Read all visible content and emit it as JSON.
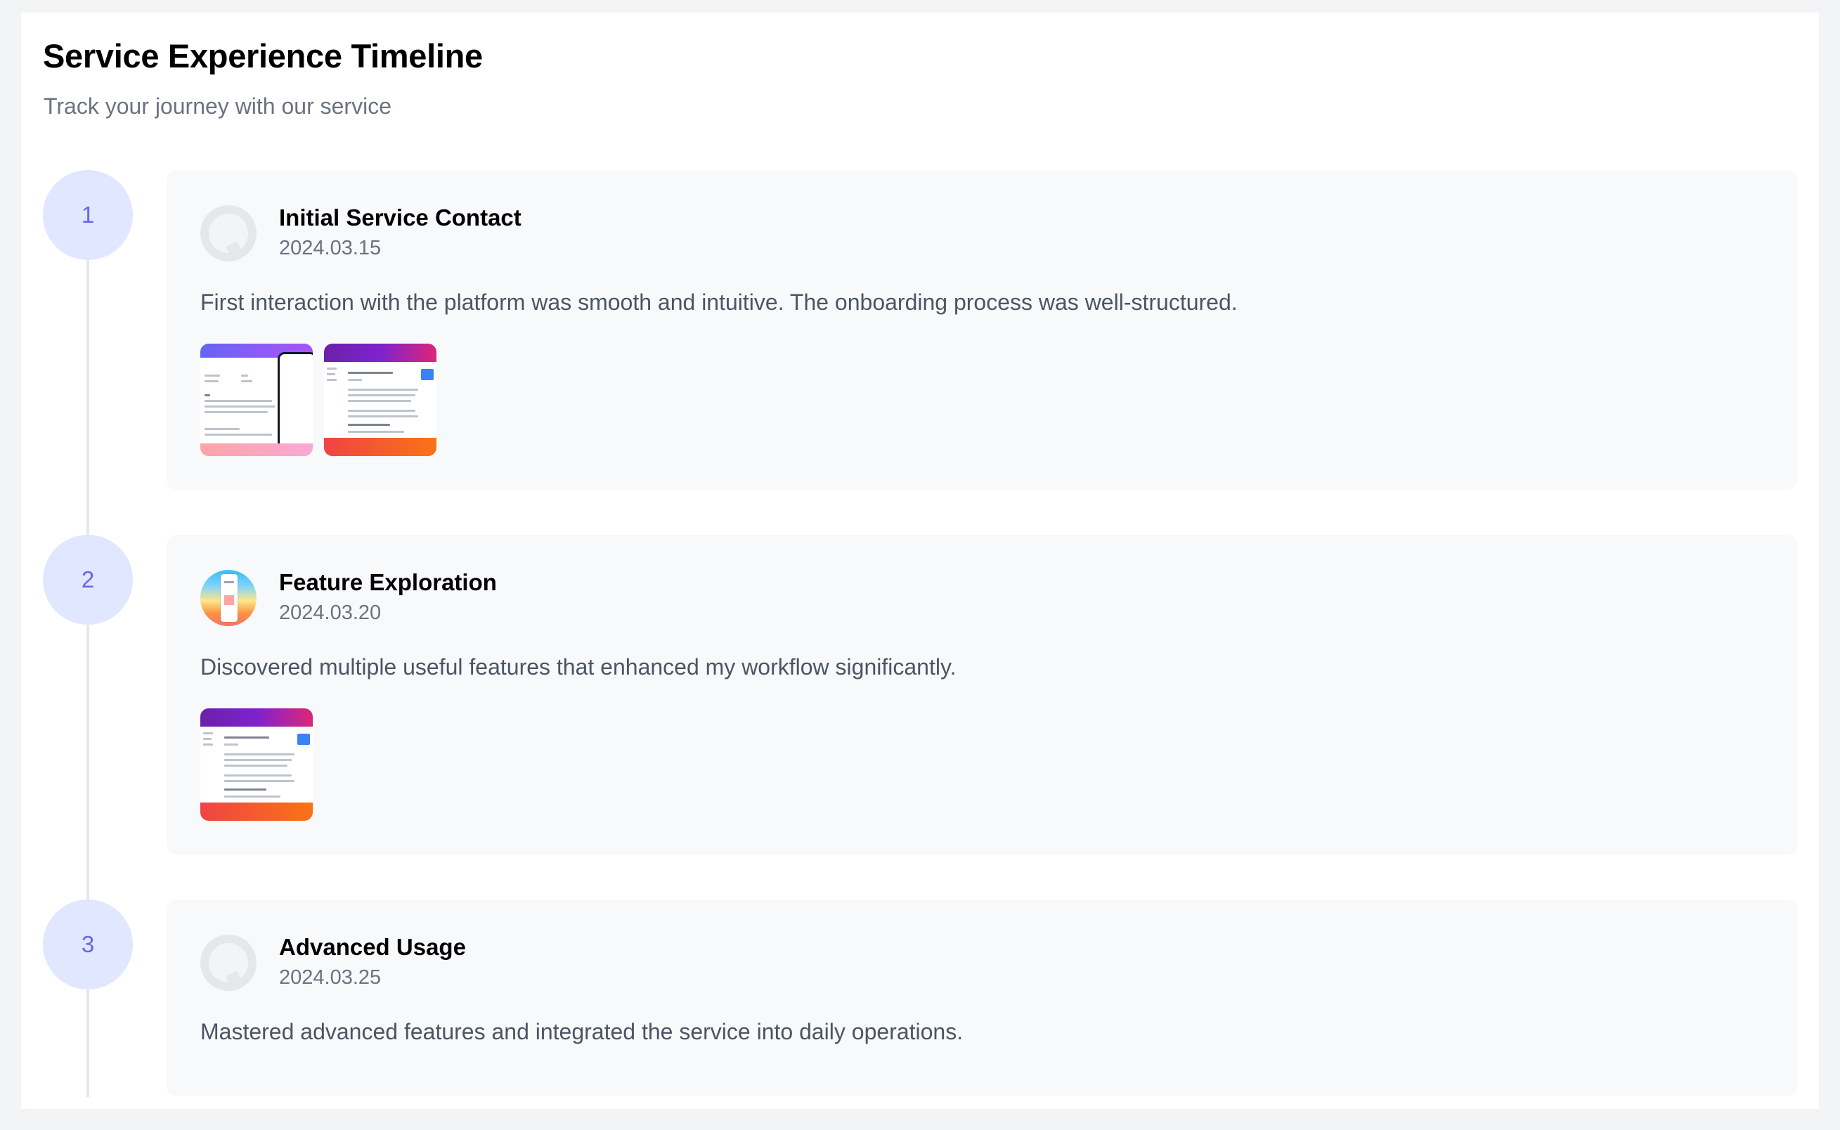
{
  "header": {
    "title": "Service Experience Timeline",
    "subtitle": "Track your journey with our service"
  },
  "timeline": [
    {
      "step": "1",
      "title": "Initial Service Contact",
      "date": "2024.03.15",
      "description": "First interaction with the platform was smooth and intuitive. The onboarding process was well-structured.",
      "avatar": "user-avatar-placeholder-icon",
      "images": [
        "mobile-dashboard-screenshot",
        "article-page-screenshot"
      ]
    },
    {
      "step": "2",
      "title": "Feature Exploration",
      "date": "2024.03.20",
      "description": "Discovered multiple useful features that enhanced my workflow significantly.",
      "avatar": "user-avatar-photo",
      "images": [
        "article-page-screenshot"
      ]
    },
    {
      "step": "3",
      "title": "Advanced Usage",
      "date": "2024.03.25",
      "description": "Mastered advanced features and integrated the service into daily operations.",
      "avatar": "user-avatar-placeholder-icon",
      "images": []
    }
  ],
  "colors": {
    "page_background": "#f3f4f6",
    "panel_background": "#ffffff",
    "card_background": "#f8f9fb",
    "step_circle_fill": "#e0e7ff",
    "step_number": "#6366f1",
    "timeline_line": "#e5e7eb",
    "muted_text": "#6b7280"
  }
}
